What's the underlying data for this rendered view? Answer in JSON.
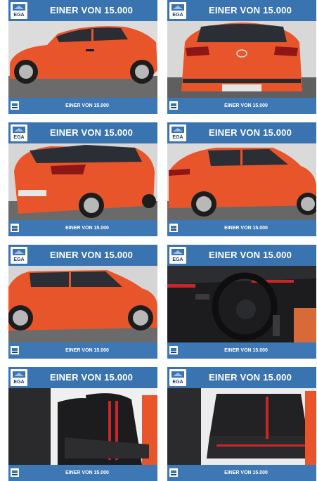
{
  "colors": {
    "brand_blue": "#3a74b0",
    "car_orange": "#e8552a",
    "interior_black": "#1c1c1e",
    "accent_red": "#c8262b"
  },
  "cards": [
    {
      "title": "EINER VON 15.000",
      "logo": "EGA",
      "caption": "EINER VON 15.000",
      "photo": "side-view-left-car-photo"
    },
    {
      "title": "EINER VON 15.000",
      "logo": "EGA",
      "caption": "EINER VON 15.000",
      "photo": "rear-view-car-photo"
    },
    {
      "title": "EINER VON 15.000",
      "logo": "EGA",
      "caption": "EINER VON 15.000",
      "photo": "rear-three-quarter-car-photo"
    },
    {
      "title": "EINER VON 15.000",
      "logo": "EGA",
      "caption": "EINER VON 15.000",
      "photo": "side-view-right-car-photo"
    },
    {
      "title": "EINER VON 15.000",
      "logo": "EGA",
      "caption": "EINER VON 15.000",
      "photo": "side-view-right-car-photo"
    },
    {
      "title": "EINER VON 15.000",
      "logo": "EGA",
      "caption": "EINER VON 15.000",
      "photo": "cockpit-interior-photo"
    },
    {
      "title": "EINER VON 15.000",
      "logo": "EGA",
      "caption": "EINER VON 15.000",
      "photo": "front-seats-interior-photo"
    },
    {
      "title": "EINER VON 15.000",
      "logo": "EGA",
      "caption": "EINER VON 15.000",
      "photo": "rear-seats-interior-photo"
    }
  ]
}
